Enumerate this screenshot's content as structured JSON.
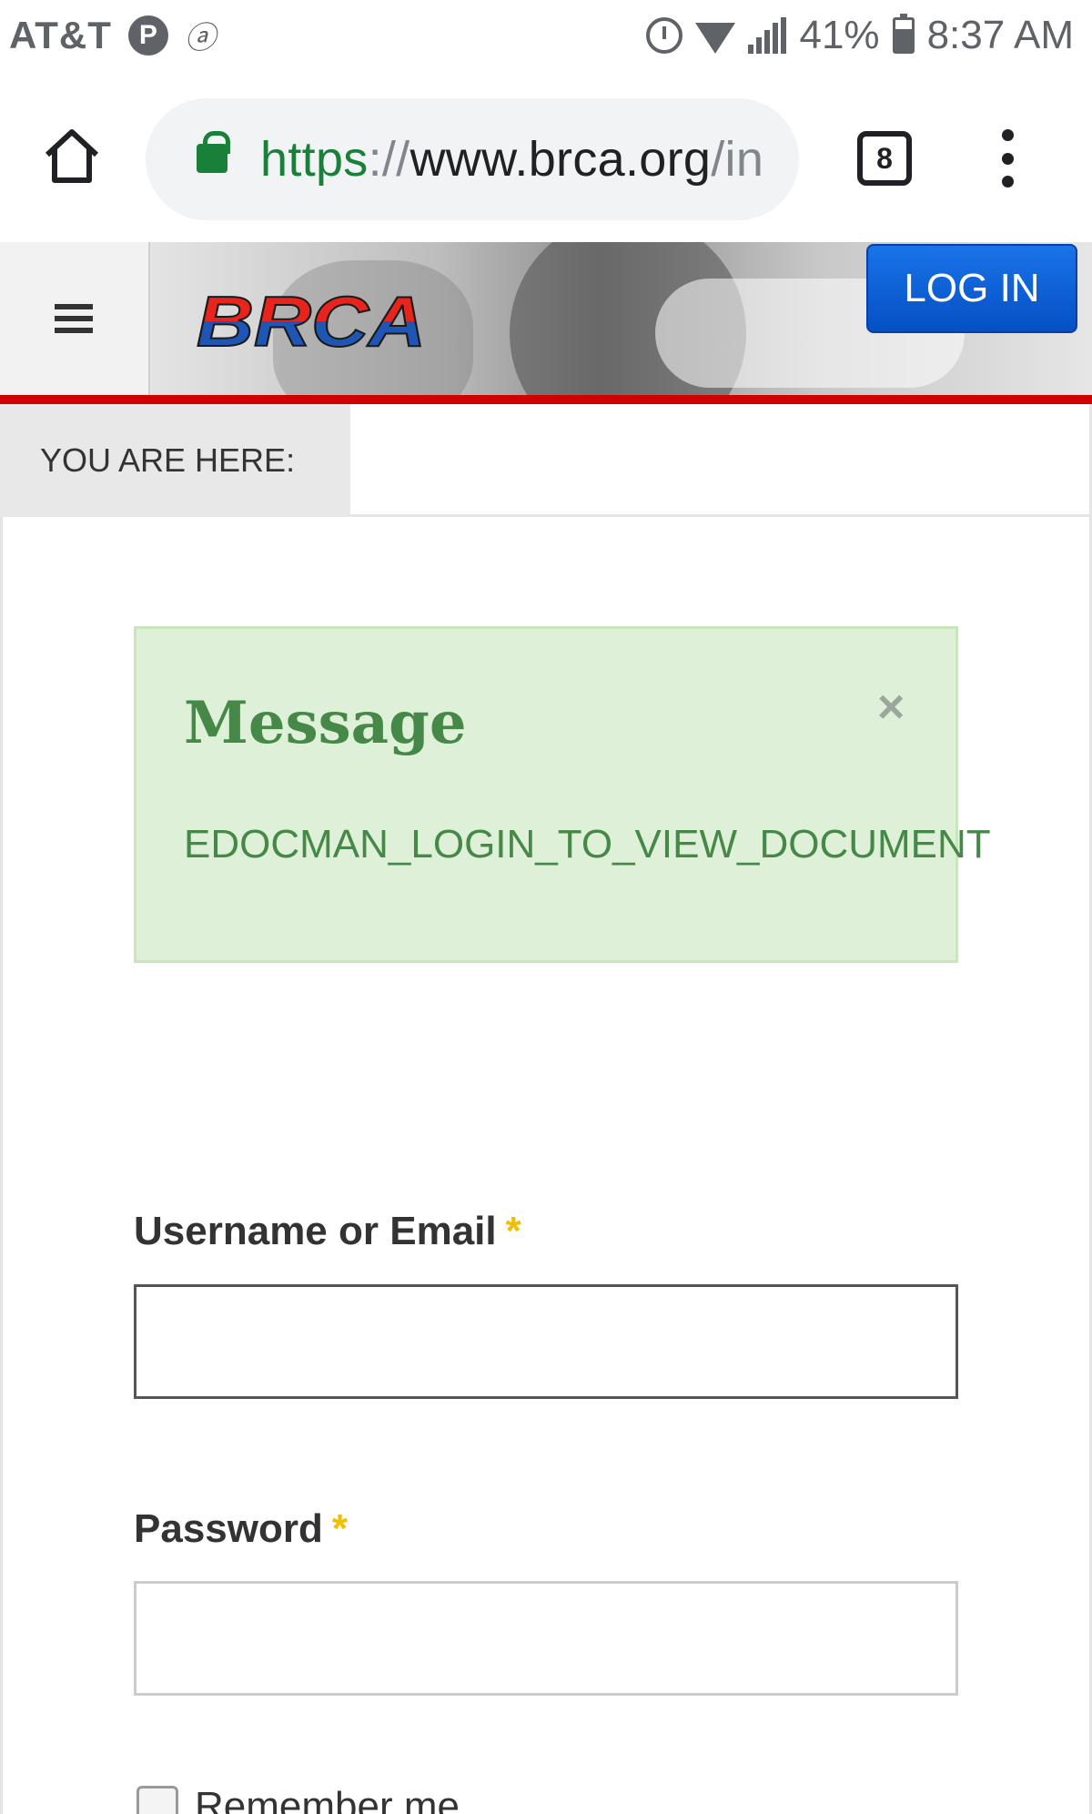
{
  "status_bar": {
    "carrier": "AT&T",
    "p_badge": "P",
    "battery_percent": "41%",
    "time": "8:37 AM"
  },
  "browser": {
    "url_scheme": "https",
    "url_sep": "://",
    "url_host": "www.brca.org",
    "url_path": "/in",
    "tab_count": "8"
  },
  "header": {
    "logo_text": "BRCA",
    "login_label": "LOG IN"
  },
  "breadcrumb": {
    "label": "YOU ARE HERE:"
  },
  "alert": {
    "title": "Message",
    "close_symbol": "×",
    "body": "EDOCMAN_LOGIN_TO_VIEW_DOCUMENT"
  },
  "form": {
    "username_label": "Username or Email",
    "password_label": "Password",
    "required_mark": "*",
    "username_value": "",
    "password_value": "",
    "remember_label": "Remember me"
  },
  "colors": {
    "alert_bg": "#dff0d8",
    "alert_text": "#468847",
    "brand_red": "#d10000",
    "login_blue": "#1a73e8",
    "required_star": "#f0c000"
  }
}
